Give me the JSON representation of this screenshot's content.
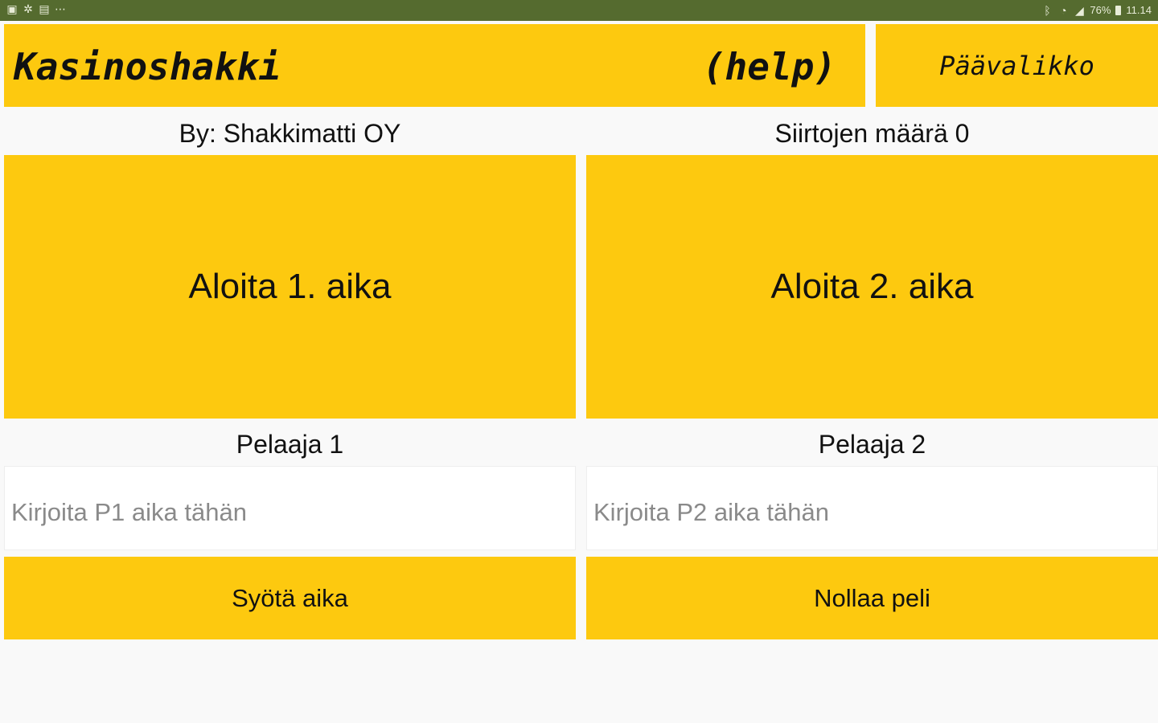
{
  "status_bar": {
    "left_icons": [
      "image-icon",
      "star-icon",
      "gallery-icon",
      "more-icon"
    ],
    "right_text": "76% 11.14",
    "battery_percent": "76%",
    "time": "11.14"
  },
  "header": {
    "title": "Kasinoshakki",
    "help_label": "(help)",
    "menu_label": "Päävalikko"
  },
  "info": {
    "author": "By: Shakkimatti OY",
    "moves_label": "Siirtojen määrä  0"
  },
  "start_buttons": {
    "player1": "Aloita 1. aika",
    "player2": "Aloita 2. aika"
  },
  "players": {
    "player1_label": "Pelaaja 1",
    "player2_label": "Pelaaja 2"
  },
  "inputs": {
    "player1_placeholder": "Kirjoita P1 aika tähän",
    "player2_placeholder": "Kirjoita P2 aika tähän",
    "player1_value": "",
    "player2_value": ""
  },
  "actions": {
    "submit_time": "Syötä aika",
    "reset_game": "Nollaa peli"
  },
  "colors": {
    "accent": "#fdc90f",
    "status_bar": "#556b2f",
    "background": "#f9f9f9"
  }
}
